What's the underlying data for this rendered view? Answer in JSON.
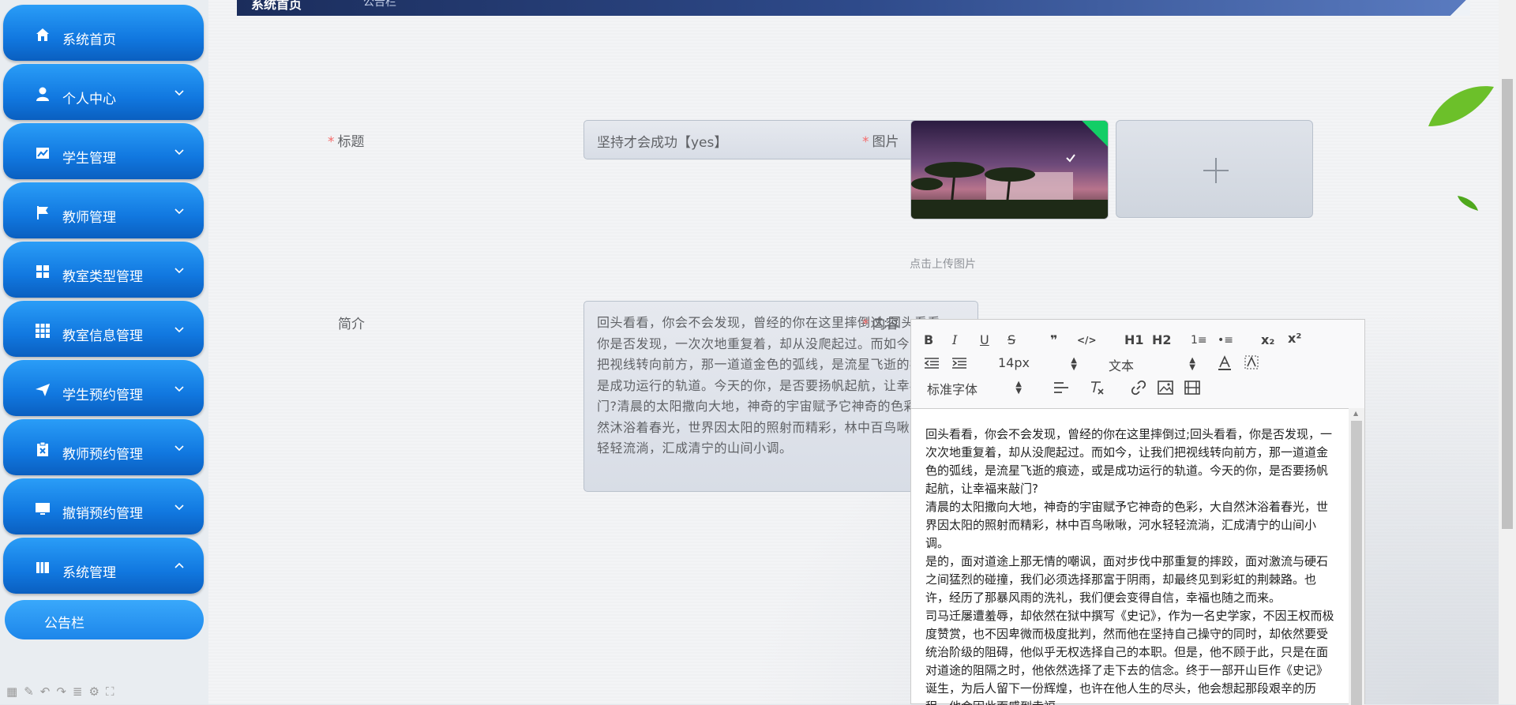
{
  "sidebar": {
    "items": [
      {
        "label": "系统首页",
        "icon": "home-icon",
        "has_arrow": false
      },
      {
        "label": "个人中心",
        "icon": "user-icon",
        "has_arrow": true
      },
      {
        "label": "学生管理",
        "icon": "chart-icon",
        "has_arrow": true
      },
      {
        "label": "教师管理",
        "icon": "flag-icon",
        "has_arrow": true
      },
      {
        "label": "教室类型管理",
        "icon": "grid-icon",
        "has_arrow": true
      },
      {
        "label": "教室信息管理",
        "icon": "apps-icon",
        "has_arrow": true
      },
      {
        "label": "学生预约管理",
        "icon": "send-icon",
        "has_arrow": true
      },
      {
        "label": "教师预约管理",
        "icon": "clipboard-icon",
        "has_arrow": true
      },
      {
        "label": "撤销预约管理",
        "icon": "monitor-icon",
        "has_arrow": true
      },
      {
        "label": "系统管理",
        "icon": "book-icon",
        "has_arrow": true,
        "expanded": true
      }
    ],
    "sub_item": "公告栏"
  },
  "topbar": {
    "title": "系统首页",
    "subtitle": "公告栏"
  },
  "form": {
    "title_label": "标题",
    "title_value": "坚持才会成功【yes】",
    "image_label": "图片",
    "upload_tip": "点击上传图片",
    "intro_label": "简介",
    "intro_value": "回头看看，你会不会发现，曾经的你在这里摔倒过;回头看看，你是否发现，一次次地重复着，却从没爬起过。而如今，让我们把视线转向前方，那一道道金色的弧线，是流星飞逝的痕迹，或是成功运行的轨道。今天的你，是否要扬帆起航，让幸福来敲门?清晨的太阳撒向大地，神奇的宇宙赋予它神奇的色彩，大自然沐浴着春光，世界因太阳的照射而精彩，林中百鸟啾啾，河水轻轻流淌，汇成清宁的山间小调。",
    "content_label": "内容"
  },
  "editor": {
    "toolbar": {
      "bold": "B",
      "italic": "I",
      "underline": "U",
      "strike": "S",
      "quote": "❞",
      "code": "</>",
      "h1": "H1",
      "h2": "H2",
      "ordered_list": "1≡",
      "bullet_list": "•≡",
      "subscript": "x₂",
      "superscript": "x²",
      "font_size": "14px",
      "header_select": "文本",
      "font_family": "标准字体"
    },
    "paragraphs": [
      "回头看看，你会不会发现，曾经的你在这里摔倒过;回头看看，你是否发现，一次次地重复着，却从没爬起过。而如今，让我们把视线转向前方，那一道道金色的弧线，是流星飞逝的痕迹，或是成功运行的轨道。今天的你，是否要扬帆起航，让幸福来敲门?",
      "清晨的太阳撒向大地，神奇的宇宙赋予它神奇的色彩，大自然沐浴着春光，世界因太阳的照射而精彩，林中百鸟啾啾，河水轻轻流淌，汇成清宁的山间小调。",
      "是的，面对道途上那无情的嘲讽，面对步伐中那重复的摔跤，面对激流与硬石之间猛烈的碰撞，我们必须选择那富于阴雨，却最终见到彩虹的荆棘路。也许，经历了那暴风雨的洗礼，我们便会变得自信，幸福也随之而来。",
      "司马迁屡遭羞辱，却依然在狱中撰写《史记》，作为一名史学家，不因王权而极度赞赏，也不因卑微而极度批判，然而他在坚持自己操守的同时，却依然要受统治阶级的阻碍，他似乎无权选择自己的本职。但是，他不顾于此，只是在面对道途的阻隔之时，他依然选择了走下去的信念。终于一部开山巨作《史记》诞生，为后人留下一份辉煌，也许在他人生的尽头，他会想起那段艰辛的历程，他会因此而感到幸福。"
    ]
  },
  "colors": {
    "menu": "#1178e0",
    "required": "#f56c6c",
    "success": "#13ce66"
  }
}
